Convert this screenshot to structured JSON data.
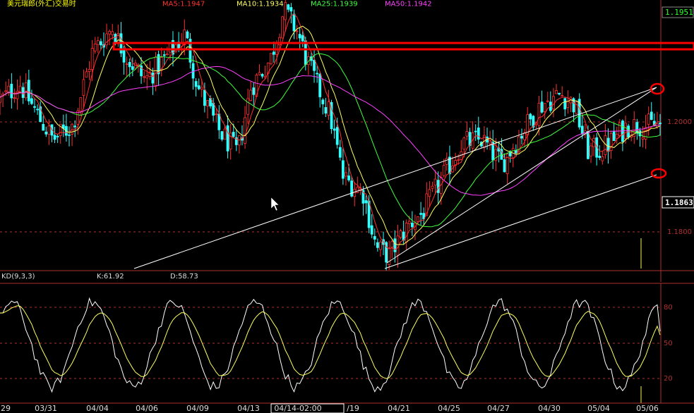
{
  "header": {
    "title": "美元瑞郎(外汇)交易时",
    "ma_labels": [
      {
        "text": "MA5:1.1947",
        "color": "#ff3030"
      },
      {
        "text": "MA10:1.1934",
        "color": "#ffff60"
      },
      {
        "text": "MA25:1.1939",
        "color": "#40ff40"
      },
      {
        "text": "MA50:1.1942",
        "color": "#ff40ff"
      }
    ]
  },
  "price_axis": {
    "top_value": "1.1951",
    "current_value": "1.1863",
    "ticks": [
      "1.2000",
      "1.1800"
    ]
  },
  "kd_header": {
    "name": "KD(9,3,3)",
    "k_label": "K:61.92",
    "d_label": "D:58.73"
  },
  "kd_axis": {
    "ticks": [
      "80",
      "50",
      "20"
    ]
  },
  "time_axis": {
    "labels": [
      "29",
      "03/31",
      "04/04",
      "04/06",
      "04/09",
      "04/13",
      "04/14-02:00",
      "/19",
      "04/21",
      "04/25",
      "04/27",
      "04/30",
      "05/04",
      "05/06"
    ],
    "highlighted": "04/14-02:00"
  },
  "colors": {
    "background": "#000000",
    "up_candle": "#ff3030",
    "down_candle": "#30ffff",
    "ma5": "#ff3030",
    "ma10": "#ffff60",
    "ma25": "#40ff40",
    "ma50": "#ff40ff",
    "k_line": "#ffffff",
    "d_line": "#ffff60",
    "grid": "#b03030",
    "trendline": "#ffffff",
    "annotation": "#ff0000"
  },
  "chart_data": [
    {
      "type": "candlestick",
      "title": "美元瑞郎(外汇)交易时",
      "ylim": [
        1.175,
        1.212
      ],
      "ytick_labels": [
        "1.2000",
        "1.1800"
      ],
      "last_price": 1.1863,
      "moving_averages": {
        "MA5": 1.1947,
        "MA10": 1.1934,
        "MA25": 1.1939,
        "MA50": 1.1942
      },
      "x_tick_labels": [
        "29",
        "03/31",
        "04/04",
        "04/06",
        "04/09",
        "04/13",
        "04/14-02:00",
        "/19",
        "04/21",
        "04/25",
        "04/27",
        "04/30",
        "05/04",
        "05/06"
      ],
      "close_path": [
        [
          0,
          1.199
        ],
        [
          0.03,
          1.2015
        ],
        [
          0.06,
          1.1965
        ],
        [
          0.08,
          1.1935
        ],
        [
          0.11,
          1.1955
        ],
        [
          0.14,
          1.206
        ],
        [
          0.17,
          1.2095
        ],
        [
          0.19,
          1.2055
        ],
        [
          0.22,
          1.202
        ],
        [
          0.25,
          1.205
        ],
        [
          0.28,
          1.2085
        ],
        [
          0.3,
          1.201
        ],
        [
          0.33,
          1.195
        ],
        [
          0.36,
          1.1915
        ],
        [
          0.38,
          1.201
        ],
        [
          0.41,
          1.205
        ],
        [
          0.43,
          1.212
        ],
        [
          0.45,
          1.209
        ],
        [
          0.47,
          1.2035
        ],
        [
          0.5,
          1.197
        ],
        [
          0.52,
          1.188
        ],
        [
          0.55,
          1.186
        ],
        [
          0.57,
          1.178
        ],
        [
          0.59,
          1.177
        ],
        [
          0.62,
          1.1815
        ],
        [
          0.64,
          1.183
        ],
        [
          0.67,
          1.188
        ],
        [
          0.7,
          1.193
        ],
        [
          0.73,
          1.1935
        ],
        [
          0.76,
          1.19
        ],
        [
          0.79,
          1.1945
        ],
        [
          0.82,
          1.1985
        ],
        [
          0.85,
          1.2
        ],
        [
          0.87,
          1.1985
        ],
        [
          0.89,
          1.192
        ],
        [
          0.91,
          1.192
        ],
        [
          0.93,
          1.1935
        ],
        [
          0.95,
          1.1955
        ]
      ],
      "annotations": {
        "resistance_band": 1.2098,
        "channel_upper": [
          [
            0.59,
            1.1745
          ],
          [
            0.95,
            1.205
          ]
        ],
        "channel_lower": [
          [
            0.59,
            1.1745
          ],
          [
            0.95,
            1.191
          ]
        ],
        "long_trendline": [
          [
            0.19,
            1.1755
          ],
          [
            0.95,
            1.205
          ]
        ]
      }
    },
    {
      "type": "line",
      "title": "KD(9,3,3)",
      "ylim": [
        0,
        100
      ],
      "ytick_labels": [
        "80",
        "50",
        "20"
      ],
      "series": [
        {
          "name": "K",
          "last": 61.92,
          "color": "#ffffff"
        },
        {
          "name": "D",
          "last": 58.73,
          "color": "#ffff60"
        }
      ]
    }
  ]
}
